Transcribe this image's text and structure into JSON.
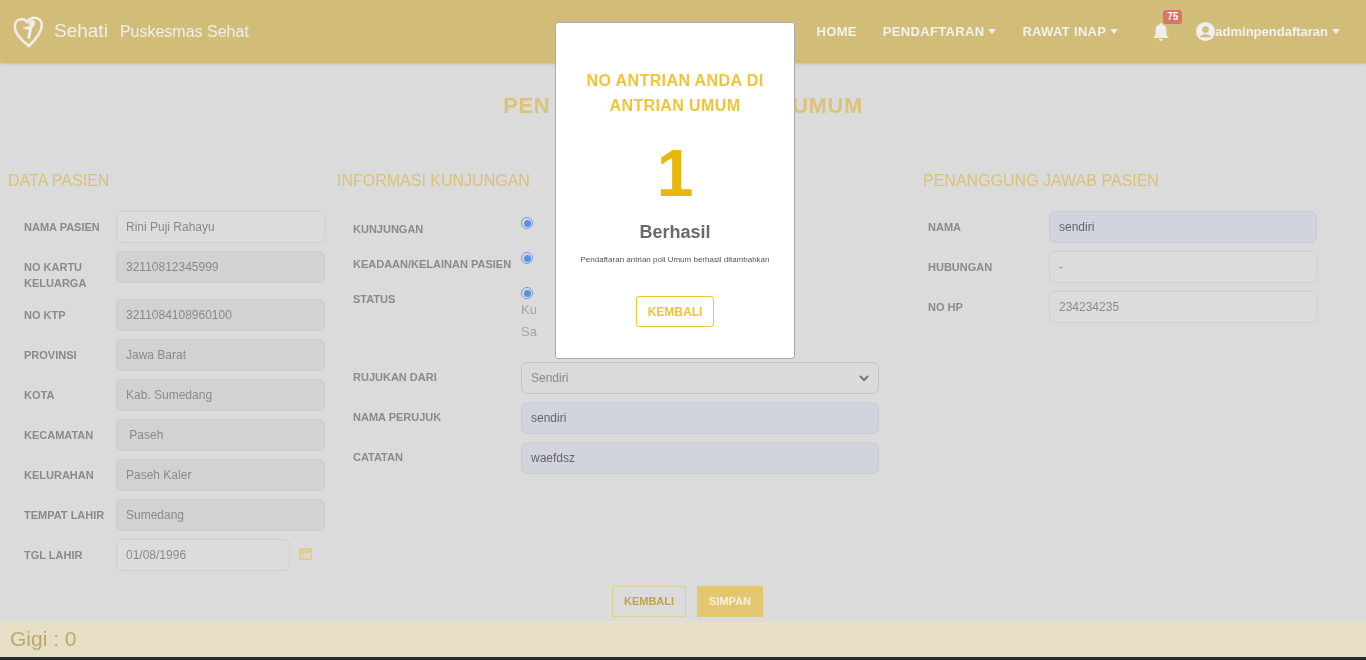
{
  "header": {
    "brand": "Sehati",
    "site": "Puskesmas Sehat",
    "nav": [
      {
        "label": "HOME",
        "kind": "link"
      },
      {
        "label": "PENDAFTARAN",
        "kind": "dropdown"
      },
      {
        "label": "RAWAT INAP",
        "kind": "dropdown"
      }
    ],
    "notifications": "75",
    "user": "adminpendaftaran"
  },
  "title_parts": [
    "PEN",
    "UMUM"
  ],
  "data_pasien": {
    "heading": "DATA PASIEN",
    "fields": [
      {
        "label": "NAMA PASIEN",
        "value": "Rini Puji Rahayu",
        "kind": "text"
      },
      {
        "label": "NO KARTU KELUARGA",
        "value": "32110812345999",
        "kind": "readonly"
      },
      {
        "label": "NO KTP",
        "value": "3211084108960100",
        "kind": "readonly"
      },
      {
        "label": "PROVINSI",
        "value": "Jawa Barat",
        "kind": "readonly"
      },
      {
        "label": "KOTA",
        "value": "Kab. Sumedang",
        "kind": "readonly"
      },
      {
        "label": "KECAMATAN",
        "value": " Paseh",
        "kind": "readonly"
      },
      {
        "label": "KELURAHAN",
        "value": "Paseh Kaler",
        "kind": "readonly"
      },
      {
        "label": "TEMPAT LAHIR",
        "value": "Sumedang",
        "kind": "readonly"
      },
      {
        "label": "TGL LAHIR",
        "value": "01/08/1996",
        "kind": "date"
      }
    ]
  },
  "informasi_kunjungan": {
    "heading": "INFORMASI KUNJUNGAN",
    "fields": [
      {
        "label": "KUNJUNGAN",
        "kind": "radio",
        "selected": true
      },
      {
        "label": "KEADAAN/KELAINAN PASIEN",
        "kind": "radio",
        "selected": true
      },
      {
        "label": "STATUS",
        "kind": "radio",
        "selected": true,
        "notes": [
          "Ku",
          "Sa"
        ]
      },
      {
        "label": "RUJUKAN DARI",
        "kind": "select",
        "value": "Sendiri"
      },
      {
        "label": "NAMA PERUJUK",
        "kind": "filled",
        "value": "sendiri"
      },
      {
        "label": "CATATAN",
        "kind": "filled",
        "value": "waefdsz"
      }
    ]
  },
  "penanggung_jawab": {
    "heading": "PENANGGUNG JAWAB PASIEN",
    "fields": [
      {
        "label": "NAMA",
        "value": "sendiri",
        "kind": "filled"
      },
      {
        "label": "HUBUNGAN",
        "value": "-",
        "kind": "text"
      },
      {
        "label": "NO HP",
        "value": "234234235",
        "kind": "text"
      }
    ]
  },
  "actions": [
    {
      "label": "KEMBALI",
      "kind": "outline"
    },
    {
      "label": "SIMPAN",
      "kind": "solid"
    }
  ],
  "footer": "Gigi : 0",
  "modal": {
    "title": "NO ANTRIAN ANDA DI ANTRIAN UMUM",
    "number": "1",
    "status": "Berhasil",
    "message": "Pendaftaran antrian poli Umum berhasil ditambahkan",
    "button": "KEMBALI"
  }
}
